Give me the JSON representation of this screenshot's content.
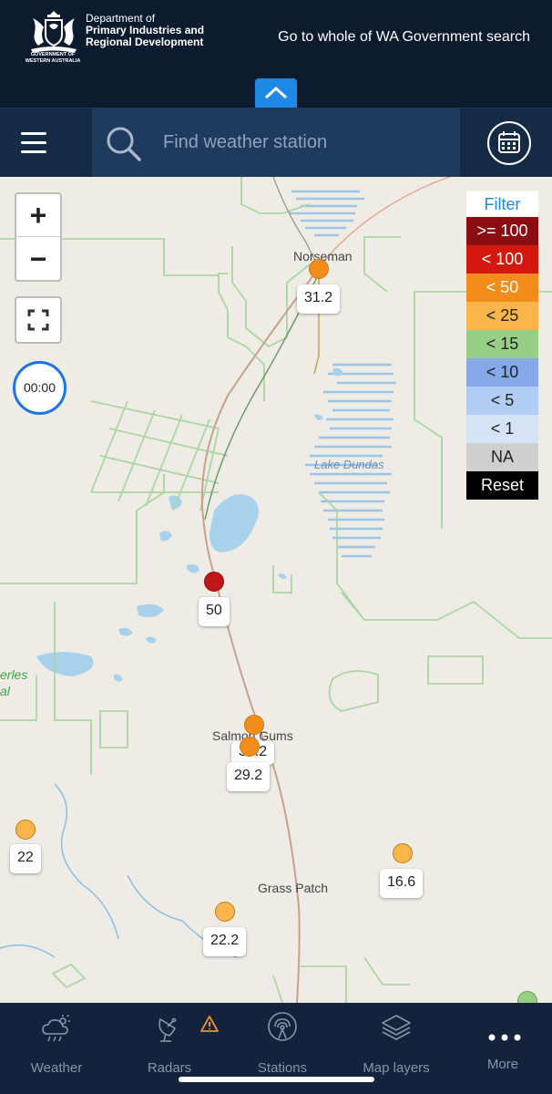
{
  "header": {
    "dept_line1": "Department of",
    "dept_line2": "Primary Industries and",
    "dept_line3": "Regional Development",
    "crest_sub1": "GOVERNMENT OF",
    "crest_sub2": "WESTERN AUSTRALIA",
    "gov_search_link": "Go to whole of WA Government search",
    "collapse_icon": "chevron-up-icon"
  },
  "toolbar": {
    "menu_icon": "hamburger-menu-icon",
    "search_placeholder": "Find weather station",
    "calendar_icon": "calendar-icon"
  },
  "map_controls": {
    "zoom_in": "+",
    "zoom_out": "−",
    "fullscreen_icon": "fullscreen-icon",
    "timer": "00:00"
  },
  "filter": {
    "title": "Filter",
    "items": [
      {
        "label": ">= 100",
        "color": "#8b0d12"
      },
      {
        "label": "< 100",
        "color": "#d4170f"
      },
      {
        "label": "< 50",
        "color": "#f28c1a"
      },
      {
        "label": "< 25",
        "color": "#f7b54a"
      },
      {
        "label": "< 15",
        "color": "#98cf86"
      },
      {
        "label": "< 10",
        "color": "#86a9ea"
      },
      {
        "label": "< 5",
        "color": "#b2cdf3"
      },
      {
        "label": "< 1",
        "color": "#d6e3f6"
      },
      {
        "label": "NA",
        "color": "#cfcfcf"
      },
      {
        "label": "Reset",
        "color": "#000000"
      }
    ]
  },
  "places": {
    "norseman": "Norseman",
    "lake_dundas": "Lake Dundas",
    "salmon_gums": "Salmon Gums",
    "grass_patch": "Grass Patch",
    "left_green_1": "erles",
    "left_green_2": "al"
  },
  "stations": [
    {
      "value": "31.2",
      "color": "#f28c1a"
    },
    {
      "value": "50",
      "color": "#c0161b"
    },
    {
      "value": "34.2",
      "color": "#f28c1a"
    },
    {
      "value": "29.2",
      "color": "#f28c1a"
    },
    {
      "value": "22",
      "color": "#f7b54a"
    },
    {
      "value": "16.6",
      "color": "#f7b54a"
    },
    {
      "value": "22.2",
      "color": "#f7b54a"
    }
  ],
  "bottom_nav": {
    "weather": "Weather",
    "radars": "Radars",
    "stations": "Stations",
    "map_layers": "Map layers",
    "more": "More"
  }
}
